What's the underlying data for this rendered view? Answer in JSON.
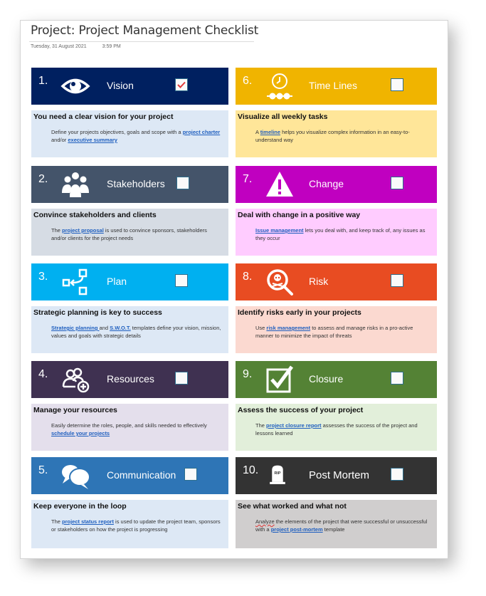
{
  "page": {
    "title": "Project: Project Management Checklist",
    "date": "Tuesday, 31 August 2021",
    "time": "3:59 PM"
  },
  "cards": [
    {
      "num": "1.",
      "label": "Vision",
      "icon": "eye-icon",
      "checked": true,
      "header_color": "#002060",
      "body_color": "#dde8f5",
      "heading": "You need a clear vision for your project",
      "desc_parts": [
        "Define your projects objectives, goals and scope with a ",
        "project charter ",
        "and/or ",
        "executive summary",
        ""
      ]
    },
    {
      "num": "2.",
      "label": "Stakeholders",
      "icon": "people-group-icon",
      "checked": false,
      "header_color": "#44546a",
      "body_color": "#d6dce4",
      "heading": "Convince stakeholders and clients",
      "desc_parts": [
        "The ",
        "project proposal",
        " is used to convince sponsors, stakeholders and/or clients for the project needs"
      ]
    },
    {
      "num": "3.",
      "label": "Plan",
      "icon": "flow-plan-icon",
      "checked": false,
      "header_color": "#00b0f0",
      "body_color": "#dde8f5",
      "heading": "Strategic planning is key to success",
      "desc_parts": [
        "",
        "Strategic planning ",
        "and ",
        "S.W.O.T.",
        " templates define your vision, mission, values and goals with strategic details"
      ]
    },
    {
      "num": "4.",
      "label": "Resources",
      "icon": "add-people-icon",
      "checked": false,
      "header_color": "#3f3151",
      "body_color": "#e4dfec",
      "heading": "Manage your resources",
      "desc_parts": [
        "Easily determine the roles, people, and skills needed to effectively ",
        "schedule your projects",
        ""
      ]
    },
    {
      "num": "5.",
      "label": "Communication",
      "icon": "chat-bubbles-icon",
      "checked": false,
      "header_color": "#2e75b6",
      "body_color": "#dde8f5",
      "heading": "Keep everyone in the loop",
      "desc_parts": [
        "The ",
        "project status report",
        " is used to update the project team, sponsors or stakeholders on how the project is progressing"
      ]
    },
    {
      "num": "6.",
      "label": "Time Lines",
      "icon": "timeline-clock-icon",
      "checked": false,
      "header_color": "#f0b400",
      "body_color": "#ffe699",
      "heading": "Visualize all weekly tasks",
      "desc_parts": [
        "A ",
        "timeline",
        " helps you visualize complex information in an easy-to-understand way"
      ]
    },
    {
      "num": "7.",
      "label": "Change",
      "icon": "warning-icon",
      "checked": false,
      "header_color": "#c000c0",
      "body_color": "#ffccff",
      "heading": "Deal with change in a positive way",
      "desc_parts": [
        "",
        "Issue management",
        " lets you deal with, and keep track of, any issues as they occur"
      ]
    },
    {
      "num": "8.",
      "label": "Risk",
      "icon": "risk-search-icon",
      "checked": false,
      "header_color": "#e84c22",
      "body_color": "#fbd9d0",
      "heading": "Identify risks early in your projects",
      "desc_parts": [
        "Use ",
        "risk management",
        " to assess and manage risks in a pro-active manner to minimize the impact of threats"
      ]
    },
    {
      "num": "9.",
      "label": "Closure",
      "icon": "check-box-icon",
      "checked": false,
      "header_color": "#548235",
      "body_color": "#e2efda",
      "heading": "Assess the success of your project",
      "desc_parts": [
        "The ",
        "project closure report",
        " assesses the success of the project and lessons learned"
      ]
    },
    {
      "num": "10.",
      "label": "Post Mortem",
      "icon": "tombstone-icon",
      "checked": false,
      "header_color": "#333333",
      "body_color": "#d0cece",
      "heading": "See what worked and what not",
      "desc_parts": [
        "Analyze",
        " the elements of the project that were successful or unsuccessful with a ",
        "project post-mortem",
        " template"
      ],
      "tombstone_text": "RIP"
    }
  ]
}
